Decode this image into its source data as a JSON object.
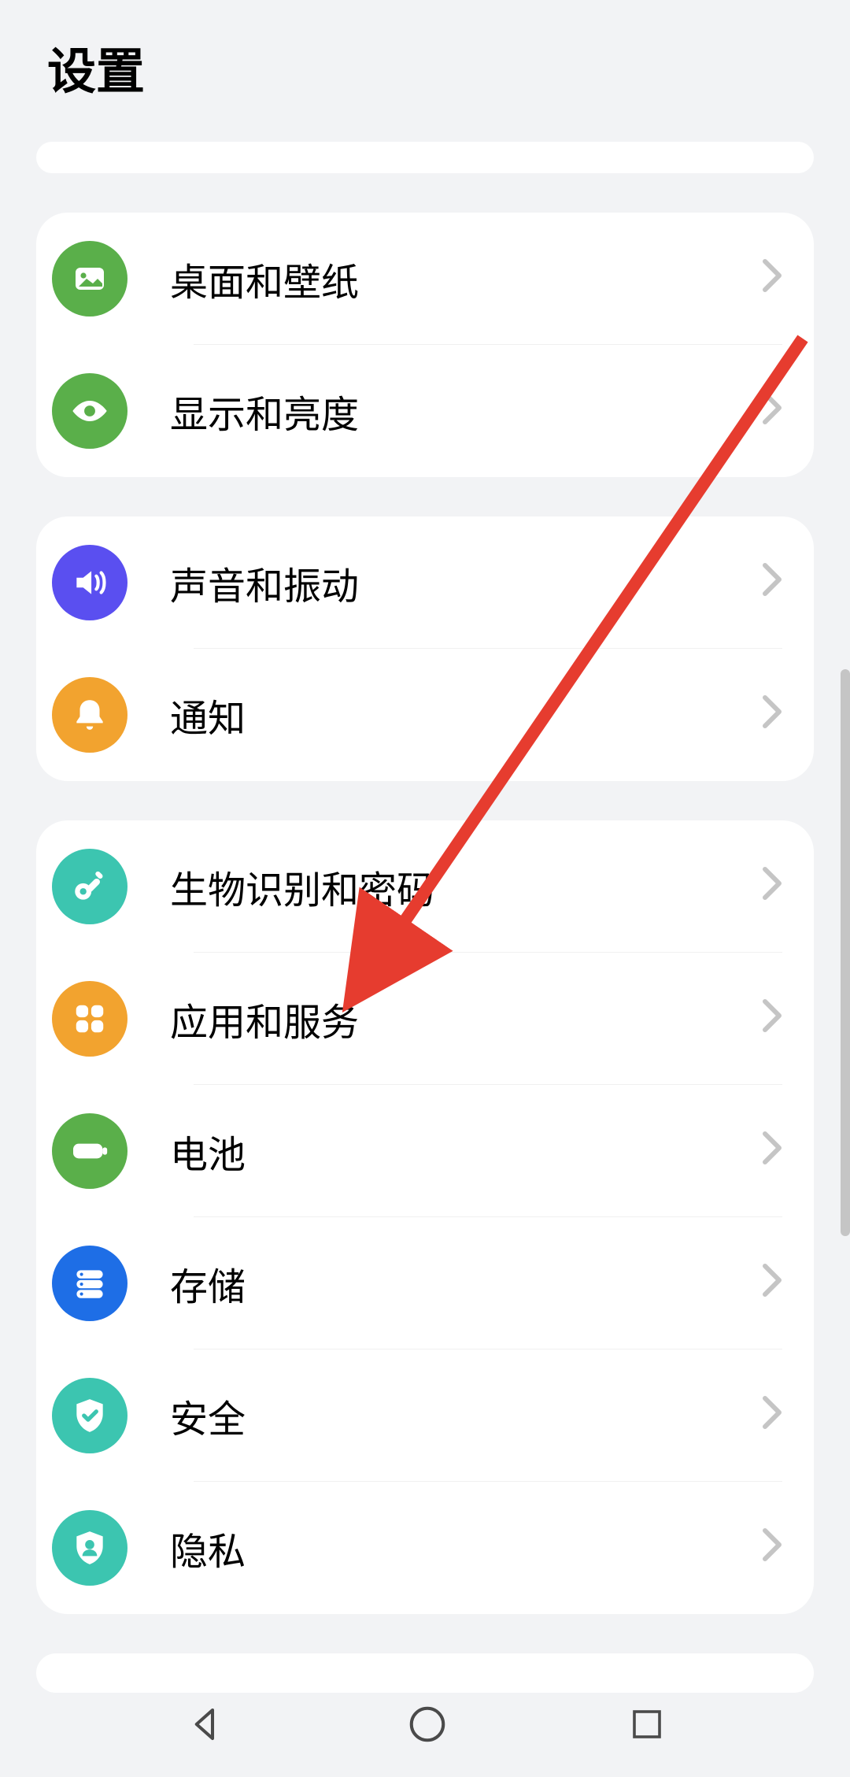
{
  "header": {
    "title": "设置"
  },
  "groups": [
    {
      "items": [
        {
          "label": "桌面和壁纸",
          "icon": "photo",
          "color": "#5aaf4a"
        },
        {
          "label": "显示和亮度",
          "icon": "eye",
          "color": "#5aaf4a"
        }
      ]
    },
    {
      "items": [
        {
          "label": "声音和振动",
          "icon": "speaker",
          "color": "#5a4ff0"
        },
        {
          "label": "通知",
          "icon": "bell",
          "color": "#f2a32f"
        }
      ]
    },
    {
      "items": [
        {
          "label": "生物识别和密码",
          "icon": "key",
          "color": "#3cc5b0"
        },
        {
          "label": "应用和服务",
          "icon": "grid",
          "color": "#f2a32f"
        },
        {
          "label": "电池",
          "icon": "battery",
          "color": "#5aaf4a"
        },
        {
          "label": "存储",
          "icon": "storage",
          "color": "#1e6ee6"
        },
        {
          "label": "安全",
          "icon": "shield-check",
          "color": "#3cc5b0"
        },
        {
          "label": "隐私",
          "icon": "shield-user",
          "color": "#3cc5b0"
        }
      ]
    }
  ],
  "annotation": {
    "arrow_color": "#e63c2f"
  }
}
